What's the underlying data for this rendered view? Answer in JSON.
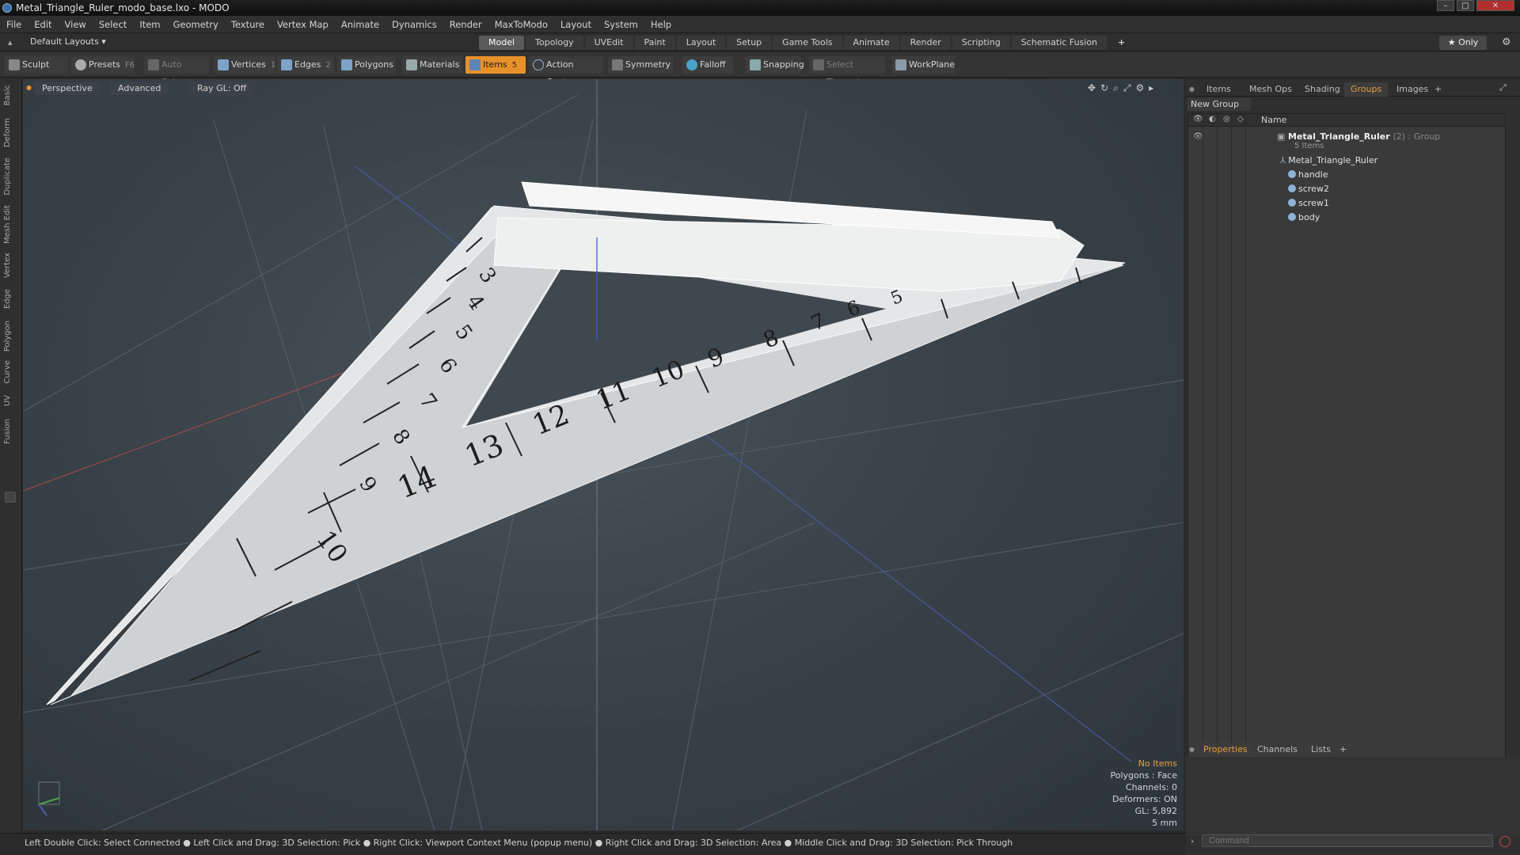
{
  "window": {
    "title": "Metal_Triangle_Ruler_modo_base.lxo - MODO",
    "controls": [
      "–",
      "□",
      "✕"
    ]
  },
  "menu": [
    "File",
    "Edit",
    "View",
    "Select",
    "Item",
    "Geometry",
    "Texture",
    "Vertex Map",
    "Animate",
    "Dynamics",
    "Render",
    "MaxToModo",
    "Layout",
    "System",
    "Help"
  ],
  "layout_selector": "Default Layouts ▾",
  "tabs": [
    "Model",
    "Topology",
    "UVEdit",
    "Paint",
    "Layout",
    "Setup",
    "Game Tools",
    "Animate",
    "Render",
    "Scripting",
    "Schematic Fusion",
    "+"
  ],
  "active_tab": "Model",
  "only_button": "★ Only",
  "toolbar": {
    "sculpt": "Sculpt",
    "presets": "Presets",
    "presets_hotkey": "F6",
    "auto_select": "Auto Select",
    "vertices": "Vertices",
    "vertices_count": "1",
    "edges": "Edges",
    "edges_count": "2",
    "polygons": "Polygons",
    "materials": "Materials",
    "items": "Items",
    "items_count": "5",
    "action_center": "Action Center",
    "symmetry": "Symmetry",
    "falloff": "Falloff",
    "snapping": "Snapping",
    "select_through": "Select Through",
    "workplane": "WorkPlane"
  },
  "left_tabs": [
    "Basic",
    "Deform",
    "Duplicate",
    "Mesh Edit",
    "Vertex",
    "Edge",
    "Polygon",
    "Curve",
    "UV",
    "Fusion"
  ],
  "viewport": {
    "view": "Perspective",
    "shading": "Advanced",
    "raygl": "Ray GL: Off",
    "ruler_numbers": [
      "3",
      "4",
      "5",
      "6",
      "7",
      "8",
      "9",
      "10",
      "14",
      "13",
      "12",
      "11",
      "10",
      "9",
      "8",
      "7",
      "6",
      "5"
    ]
  },
  "stats": {
    "selection": "No Items",
    "polygons": "Polygons : Face",
    "channels": "Channels: 0",
    "deformers": "Deformers: ON",
    "gl": "GL: 5,892",
    "unit": "5 mm"
  },
  "status_bar": "Left Double Click: Select Connected ● Left Click and Drag: 3D Selection: Pick ● Right Click: Viewport Context Menu (popup menu) ● Right Click and Drag: 3D Selection: Area ● Middle Click and Drag: 3D Selection: Pick Through",
  "right_panel": {
    "tabs": [
      "Items",
      "Mesh Ops",
      "Shading",
      "Groups",
      "Images",
      "+"
    ],
    "active_tab": "Groups",
    "new_group": "New Group",
    "column_name": "Name",
    "group": {
      "name": "Metal_Triangle_Ruler",
      "meta": "(2) : Group",
      "subtitle": "5 Items"
    },
    "items": [
      "Metal_Triangle_Ruler",
      "handle",
      "screw2",
      "screw1",
      "body"
    ],
    "bottom_tabs": [
      "Properties",
      "Channels",
      "Lists",
      "+"
    ],
    "bottom_active": "Properties",
    "command_placeholder": "Command"
  },
  "colors": {
    "accent": "#e8912a",
    "viewport_bg": "#3a434a"
  }
}
